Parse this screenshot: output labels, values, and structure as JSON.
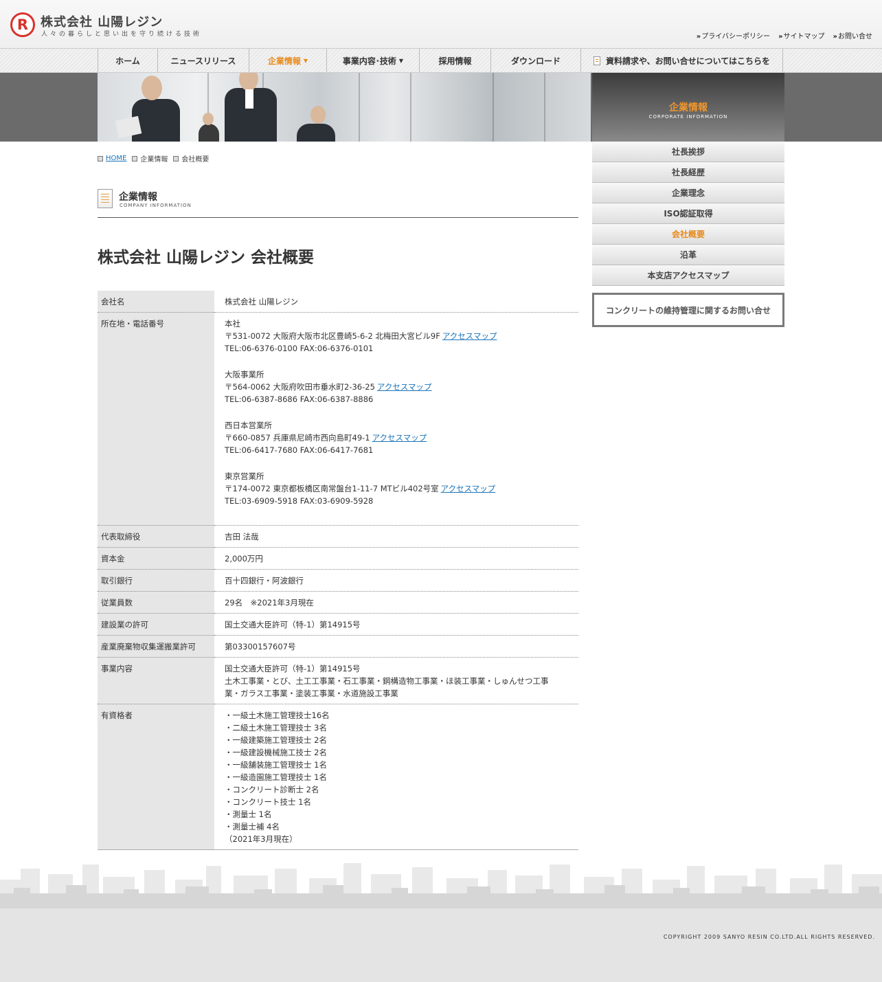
{
  "header": {
    "logo_mark": "R",
    "company_name": "株式会社 山陽レジン",
    "tagline": "人々の暮らしと思い出を守り続ける技術",
    "util_links": [
      "プライバシーポリシー",
      "サイトマップ",
      "お問い合せ"
    ]
  },
  "nav": {
    "items": [
      "ホーム",
      "ニュースリリース",
      "企業情報",
      "事業内容･技術",
      "採用情報",
      "ダウンロード"
    ],
    "contact": "資料請求や、お問い合せについてはこちらを"
  },
  "hero": {
    "title_jp": "企業情報",
    "title_en": "CORPORATE INFORMATION"
  },
  "breadcrumb": {
    "home": "HOME",
    "level1": "企業情報",
    "level2": "会社概要"
  },
  "section": {
    "title_jp": "企業情報",
    "title_en": "COMPANY INFORMATION"
  },
  "page_title": "株式会社 山陽レジン 会社概要",
  "access_label": "アクセスマップ",
  "table": {
    "company_label": "会社名",
    "company_value": "株式会社 山陽レジン",
    "locations_label": "所在地・電話番号",
    "locations": [
      {
        "name": "本社",
        "address": "〒531-0072  大阪府大阪市北区豊崎5-6-2  北梅田大宮ビル9F",
        "tel": "TEL:06-6376-0100  FAX:06-6376-0101"
      },
      {
        "name": "大阪事業所",
        "address": "〒564-0062  大阪府吹田市垂水町2-36-25",
        "tel": "TEL:06-6387-8686  FAX:06-6387-8886"
      },
      {
        "name": "西日本営業所",
        "address": "〒660-0857  兵庫県尼崎市西向島町49-1",
        "tel": "TEL:06-6417-7680  FAX:06-6417-7681"
      },
      {
        "name": "東京営業所",
        "address": "〒174-0072  東京都板橋区南常盤台1-11-7  MTビル402号室",
        "tel": "TEL:03-6909-5918  FAX:03-6909-5928"
      }
    ],
    "ceo_label": "代表取締役",
    "ceo_value": "吉田 法哉",
    "capital_label": "資本金",
    "capital_value": "2,000万円",
    "bank_label": "取引銀行",
    "bank_value": "百十四銀行・阿波銀行",
    "employees_label": "従業員数",
    "employees_value": "29名　※2021年3月現在",
    "license_label": "建設業の許可",
    "license_value": "国土交通大臣許可（特-1）第14915号",
    "waste_label": "産業廃棄物収集運搬業許可",
    "waste_value": "第03300157607号",
    "business_label": "事業内容",
    "business_lines": [
      "国土交通大臣許可（特-1）第14915号",
      "土木工事業・とび、土工工事業・石工事業・鋼構造物工事業・ほ装工事業・しゅんせつ工事",
      "業・ガラス工事業・塗装工事業・水道施設工事業"
    ],
    "qualified_label": "有資格者",
    "qualified_lines": [
      "・一級土木施工管理技士16名",
      "・二級土木施工管理技士  3名",
      "・一級建築施工管理技士  2名",
      "・一級建設機械施工技士  2名",
      "・一級舗装施工管理技士  1名",
      "・一級造園施工管理技士  1名",
      "・コンクリート診断士  2名",
      "・コンクリート技士  1名",
      "・測量士  1名",
      "・測量士補  4名",
      "（2021年3月現在）"
    ]
  },
  "sidebar": {
    "items": [
      "社長挨拶",
      "社長経歴",
      "企業理念",
      "ISO認証取得",
      "会社概要",
      "沿革",
      "本支店アクセスマップ"
    ],
    "contact_banner": "コンクリートの維持管理に関するお問い合せ"
  },
  "footer": {
    "copyright": "COPYRIGHT 2009 SANYO RESIN CO.LTD.ALL RIGHTS RESERVED."
  }
}
